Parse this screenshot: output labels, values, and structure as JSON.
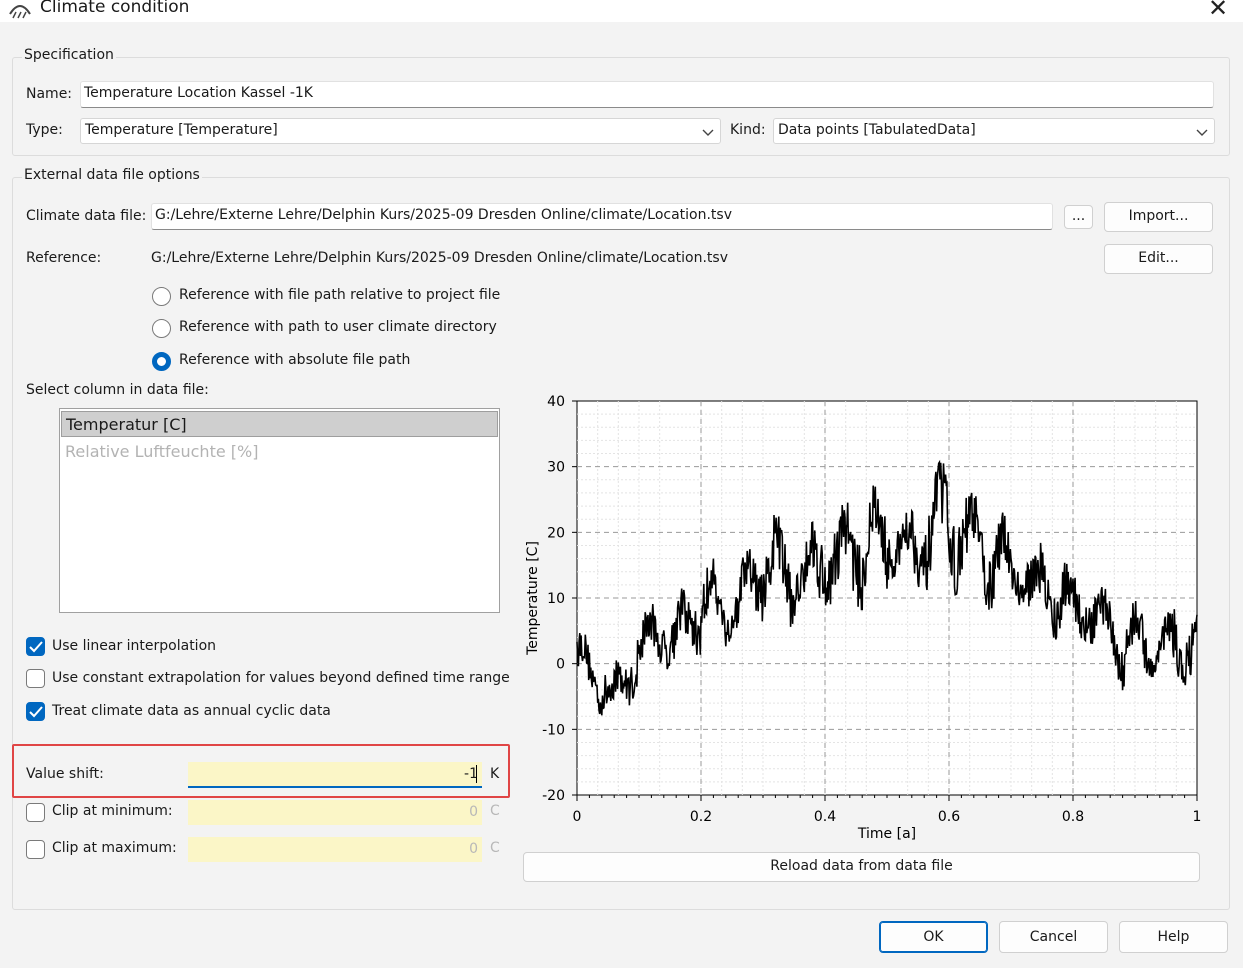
{
  "window": {
    "title": "Climate condition",
    "icon": "climate-app-icon",
    "close_icon": "close-icon"
  },
  "specification": {
    "group_title": "Specification",
    "name_label": "Name:",
    "name_value": "Temperature Location Kassel -1K",
    "type_label": "Type:",
    "type_value": "Temperature [Temperature]",
    "kind_label": "Kind:",
    "kind_value": "Data points [TabulatedData]"
  },
  "external": {
    "group_title": "External data file options",
    "file_label": "Climate data file:",
    "file_value": "G:/Lehre/Externe Lehre/Delphin Kurs/2025-09 Dresden Online/climate/Location.tsv",
    "browse_label": "...",
    "import_label": "Import...",
    "reference_label": "Reference:",
    "reference_value": "G:/Lehre/Externe Lehre/Delphin Kurs/2025-09 Dresden Online/climate/Location.tsv",
    "edit_label": "Edit...",
    "radios": [
      {
        "label": "Reference with file path relative to project file",
        "checked": false
      },
      {
        "label": "Reference with path to user climate directory",
        "checked": false
      },
      {
        "label": "Reference with absolute file path",
        "checked": true
      }
    ],
    "column_label": "Select column in data file:",
    "columns": [
      {
        "label": "Temperatur [C]",
        "selected": true
      },
      {
        "label": "Relative Luftfeuchte [%]",
        "selected": false
      }
    ],
    "checkboxes": [
      {
        "label": "Use linear interpolation",
        "checked": true
      },
      {
        "label": "Use constant extrapolation for values beyond defined time range",
        "checked": false
      },
      {
        "label": "Treat climate data as annual cyclic data",
        "checked": true
      }
    ],
    "value_shift_label": "Value shift:",
    "value_shift_value": "-1",
    "value_shift_unit": "K",
    "clip_min_label": "Clip at minimum:",
    "clip_min_value": "0",
    "clip_min_unit": "C",
    "clip_max_label": "Clip at maximum:",
    "clip_max_value": "0",
    "clip_max_unit": "C",
    "reload_label": "Reload data from data file"
  },
  "chart_data": {
    "type": "line",
    "title": "",
    "xlabel": "Time [a]",
    "ylabel": "Temperature [C]",
    "xlim": [
      0,
      1
    ],
    "ylim": [
      -20,
      40
    ],
    "xticks": [
      "0",
      "0.2",
      "0.4",
      "0.6",
      "0.8",
      "1"
    ],
    "yticks": [
      "-20",
      "-10",
      "0",
      "10",
      "20",
      "30",
      "40"
    ],
    "grid": true,
    "series_color": "#000000",
    "series": [
      {
        "name": "",
        "x": [
          0,
          0.02,
          0.04,
          0.06,
          0.08,
          0.1,
          0.12,
          0.14,
          0.16,
          0.18,
          0.2,
          0.22,
          0.24,
          0.26,
          0.28,
          0.3,
          0.32,
          0.34,
          0.36,
          0.38,
          0.4,
          0.42,
          0.44,
          0.46,
          0.48,
          0.5,
          0.52,
          0.54,
          0.56,
          0.58,
          0.6,
          0.62,
          0.64,
          0.66,
          0.68,
          0.7,
          0.72,
          0.74,
          0.76,
          0.78,
          0.8,
          0.82,
          0.84,
          0.86,
          0.88,
          0.9,
          0.92,
          0.94,
          0.96,
          0.98,
          1
        ],
        "y_min": [
          -3,
          -6,
          -8,
          -11,
          -7,
          -4,
          -2,
          0,
          -3,
          2,
          1,
          3,
          2,
          4,
          6,
          5,
          7,
          4,
          8,
          6,
          9,
          7,
          10,
          8,
          11,
          10,
          12,
          9,
          11,
          12,
          10,
          11,
          12,
          8,
          9,
          7,
          8,
          5,
          3,
          4,
          2,
          3,
          1,
          0,
          -5,
          -2,
          -3,
          -2,
          -3,
          -4,
          -5
        ],
        "y_max": [
          6,
          4,
          2,
          0,
          3,
          8,
          9,
          10,
          11,
          12,
          17,
          16,
          14,
          15,
          18,
          24,
          23,
          21,
          20,
          22,
          25,
          23,
          26,
          28,
          27,
          26,
          24,
          25,
          27,
          30,
          33,
          28,
          26,
          23,
          24,
          21,
          20,
          18,
          19,
          17,
          15,
          14,
          12,
          11,
          9,
          10,
          8,
          7,
          9,
          10,
          8
        ]
      }
    ]
  },
  "footer": {
    "ok_label": "OK",
    "cancel_label": "Cancel",
    "help_label": "Help"
  }
}
